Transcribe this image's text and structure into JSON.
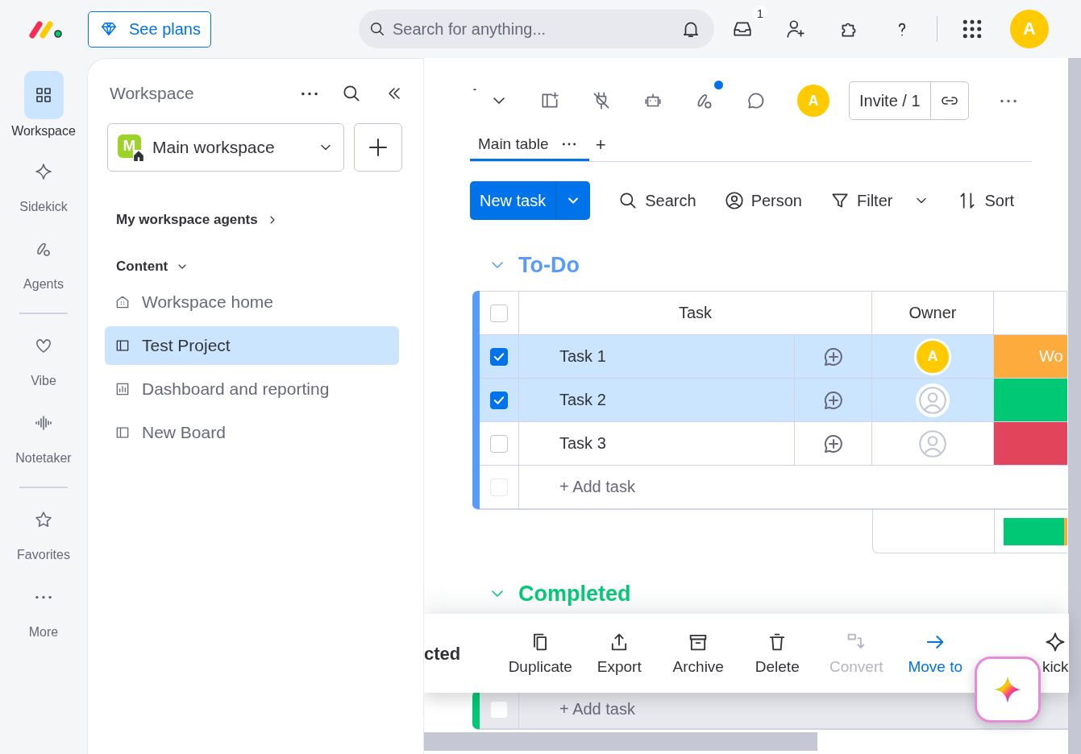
{
  "topbar": {
    "plans_button": "See plans",
    "search": {
      "placeholder": "Search for anything..."
    },
    "inbox_badge": "1",
    "avatar": "A"
  },
  "rail_groups": [
    [
      {
        "label": "Workspace",
        "selected": true
      },
      {
        "label": "Sidekick",
        "selected": false
      },
      {
        "label": "Agents",
        "selected": false
      }
    ],
    [
      {
        "label": "Vibe",
        "selected": false
      },
      {
        "label": "Notetaker",
        "selected": false
      }
    ],
    [
      {
        "label": "Favorites",
        "selected": false
      },
      {
        "label": "More",
        "selected": false
      }
    ]
  ],
  "sidebar": {
    "title": "Workspace",
    "workspace": {
      "initial": "M",
      "name": "Main workspace"
    },
    "agents_link": "My workspace agents",
    "section": {
      "label": "Content",
      "expanded": true
    },
    "items": [
      {
        "label": "Workspace home",
        "selected": false
      },
      {
        "label": "Test Project",
        "selected": true
      },
      {
        "label": "Dashboard and reporting",
        "selected": false
      },
      {
        "label": "New Board",
        "selected": false
      }
    ]
  },
  "board": {
    "title": "-",
    "activity_dot": true,
    "avatar": "A",
    "invite": "Invite / 1",
    "views": [
      {
        "label": "Main table",
        "selected": true
      }
    ],
    "add_view": "+",
    "new_task": "New task",
    "tools": [
      "Search",
      "Person",
      "Filter",
      "Sort"
    ],
    "groups": [
      {
        "title": "To-Do",
        "color": "#579bfc",
        "expanded": true,
        "columns": [
          "Task",
          "Owner"
        ],
        "all_checked": false,
        "add_row_checked": false,
        "rows": [
          {
            "name": "Task 1",
            "checked": true,
            "owner": {
              "kind": "avatar",
              "initial": "A"
            },
            "status": {
              "color": "#fdab3d",
              "label": "Wo"
            }
          },
          {
            "name": "Task 2",
            "checked": true,
            "owner": {
              "kind": "empty"
            },
            "status": {
              "color": "#00c875"
            }
          },
          {
            "name": "Task 3",
            "checked": false,
            "owner": {
              "kind": "empty"
            },
            "status": {
              "color": "#e2445c"
            }
          }
        ],
        "add_row": "+ Add task"
      },
      {
        "title": "Completed",
        "color": "#00c875",
        "expanded": true,
        "add_row": "+ Add task",
        "add_row_checked": false
      }
    ]
  },
  "action_bar": {
    "selected_label": "cted",
    "actions": [
      {
        "label": "Duplicate",
        "disabled": false,
        "highlighted": false
      },
      {
        "label": "Export",
        "disabled": false,
        "highlighted": false
      },
      {
        "label": "Archive",
        "disabled": false,
        "highlighted": false
      },
      {
        "label": "Delete",
        "disabled": false,
        "highlighted": false
      },
      {
        "label": "Convert",
        "disabled": true,
        "highlighted": false
      },
      {
        "label": "Move to",
        "disabled": false,
        "highlighted": true
      },
      {
        "label": "kick",
        "disabled": false,
        "highlighted": false
      }
    ]
  }
}
